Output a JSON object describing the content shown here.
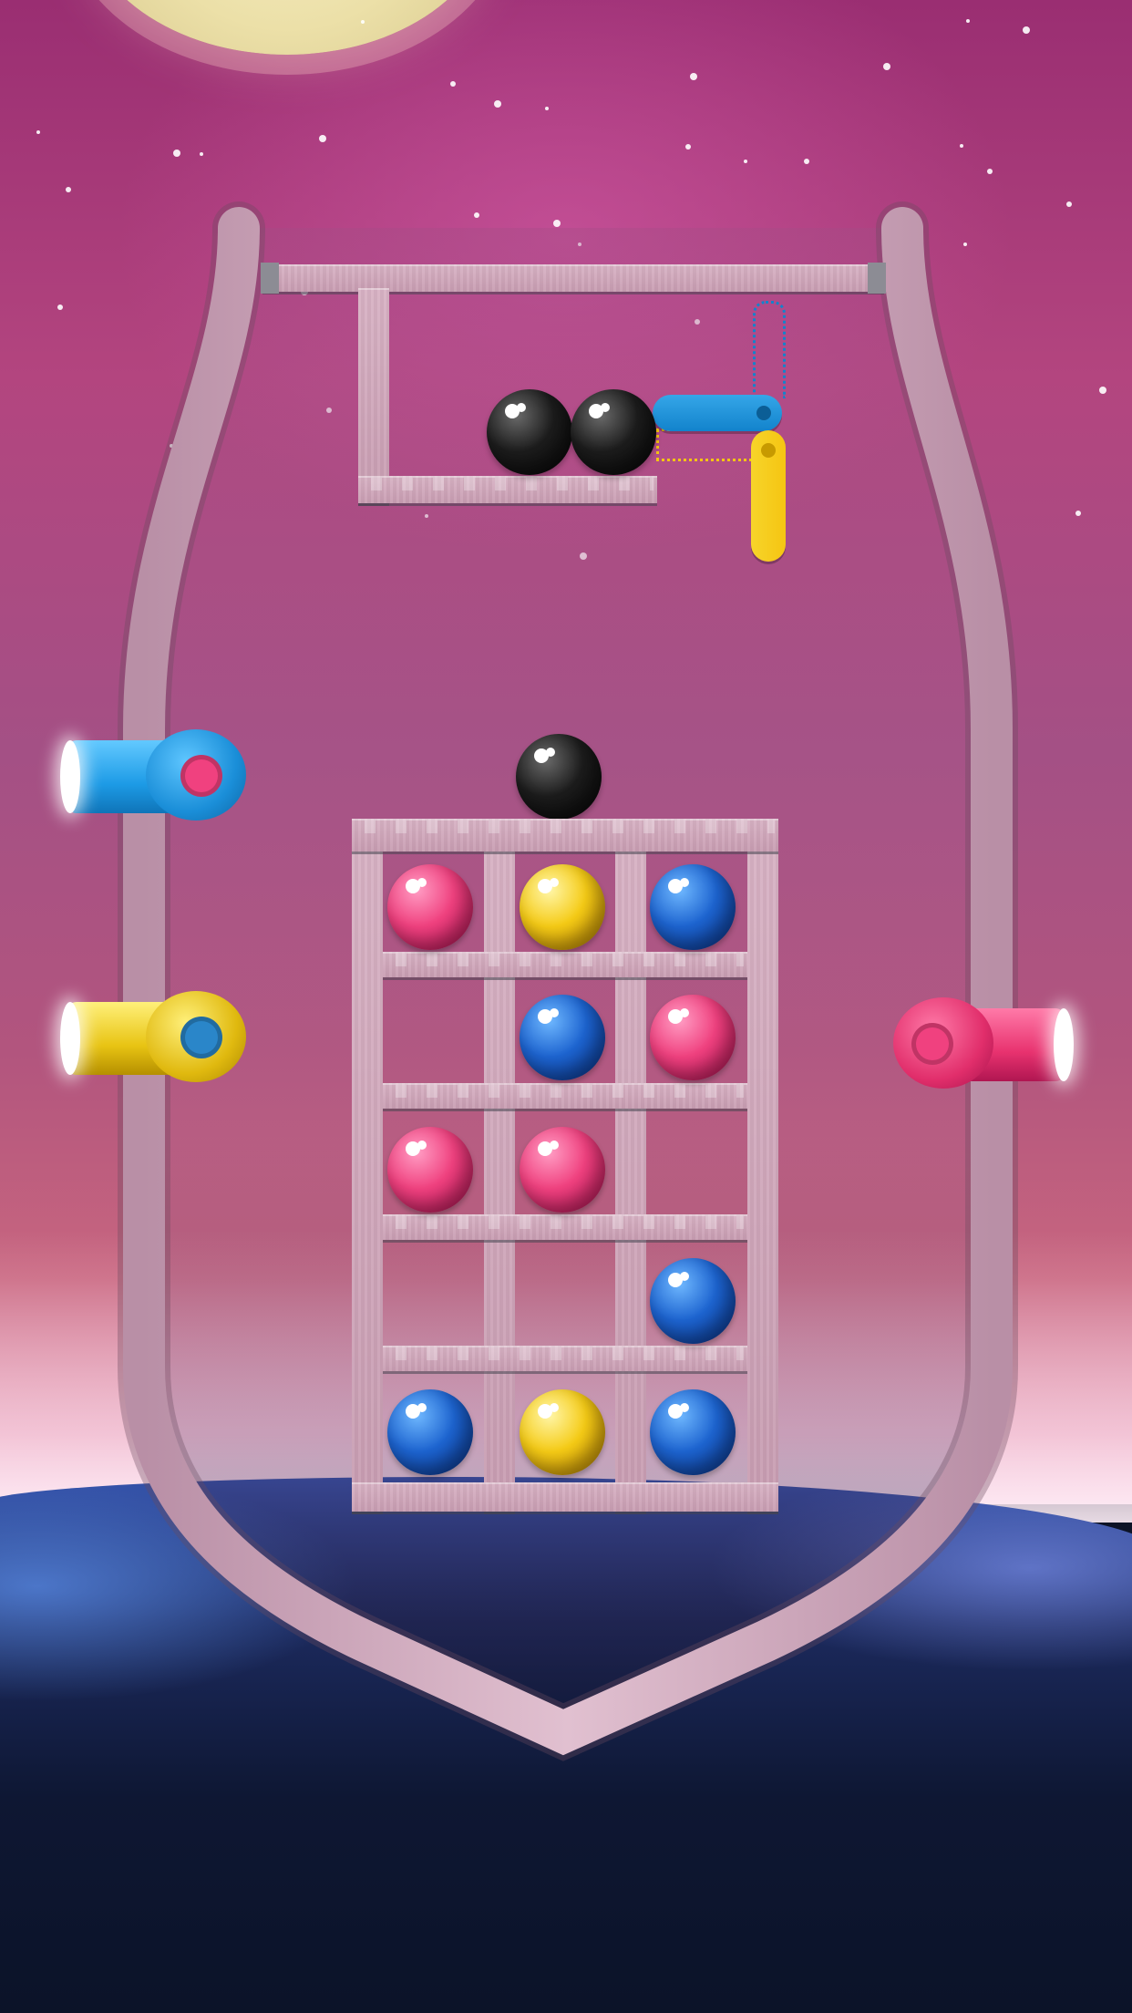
{
  "scene": {
    "title": "",
    "colors": {
      "pink": "#f0417f",
      "yellow": "#f5cb16",
      "blue": "#1d64d0",
      "black": "#1c1c1c",
      "pin_blue": "#1283cc",
      "pin_yellow": "#f5c512",
      "wood": "#d3aabd"
    }
  },
  "cannons": [
    {
      "id": "left-top",
      "side": "left",
      "barrel_color": "cyan",
      "gem_color": "pink"
    },
    {
      "id": "left-bottom",
      "side": "left",
      "barrel_color": "yellow",
      "gem_color": "blue"
    },
    {
      "id": "right",
      "side": "right",
      "barrel_color": "pink",
      "gem_color": "pink"
    }
  ],
  "upper_chamber": {
    "balls": [
      "black",
      "black"
    ],
    "pins": [
      "blue",
      "yellow"
    ]
  },
  "falling_ball": "black",
  "grid": {
    "rows": 5,
    "cols": 3,
    "cells": [
      [
        "pink",
        "yellow",
        "blue"
      ],
      [
        "",
        "blue",
        "pink"
      ],
      [
        "pink",
        "pink",
        ""
      ],
      [
        "",
        "",
        "blue"
      ],
      [
        "blue",
        "yellow",
        "blue"
      ]
    ]
  }
}
